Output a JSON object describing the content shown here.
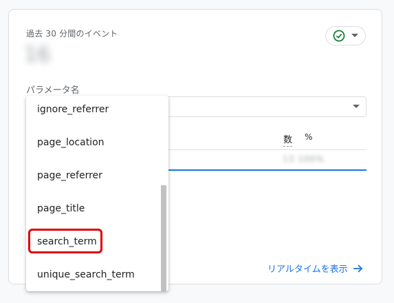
{
  "card": {
    "events_title": "過去 30 分間のイベント",
    "events_count": "16",
    "param_label": "パラメータ名",
    "table": {
      "col_count": "数",
      "col_percent": "%",
      "row_values": "13 100%"
    },
    "realtime_link": "リアルタイムを表示"
  },
  "dropdown": {
    "items": [
      "ignore_referrer",
      "page_location",
      "page_referrer",
      "page_title",
      "search_term",
      "unique_search_term"
    ],
    "selected_index": 4
  },
  "colors": {
    "accent": "#1a73e8",
    "status_ok": "#188038",
    "highlight": "#e00000"
  },
  "icons": {
    "status": "check-circle-icon",
    "chip_caret": "caret-down-icon",
    "link_arrow": "arrow-right-icon"
  }
}
